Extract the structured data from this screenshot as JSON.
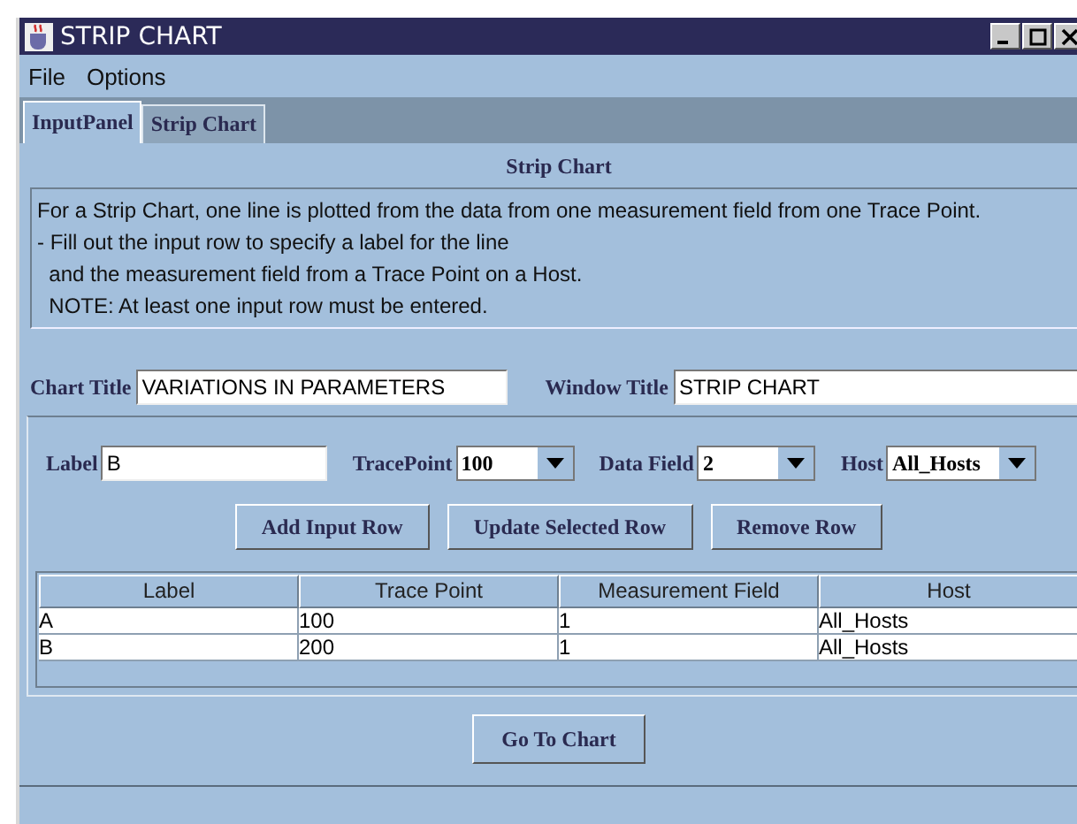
{
  "window": {
    "title": "STRIP CHART"
  },
  "menu": [
    "File",
    "Options"
  ],
  "tabs": [
    {
      "label": "InputPanel",
      "selected": true
    },
    {
      "label": "Strip Chart",
      "selected": false
    }
  ],
  "heading": "Strip Chart",
  "description": [
    "For a Strip Chart, one line is plotted from the data from one measurement field from one Trace Point.",
    "- Fill out the input row to specify a label for the line",
    "  and the measurement field from a Trace Point on a Host.",
    "  NOTE: At least one input row must be entered."
  ],
  "title_fields": [
    {
      "label": "Chart Title",
      "value": "VARIATIONS IN PARAMETERS"
    },
    {
      "label": "Window Title",
      "value": "STRIP CHART"
    }
  ],
  "input_row": [
    {
      "kind": "text",
      "label": "Label",
      "value": "B"
    },
    {
      "kind": "combo",
      "label": "TracePoint",
      "value": "100"
    },
    {
      "kind": "combo",
      "label": "Data Field",
      "value": "2"
    },
    {
      "kind": "combo",
      "label": "Host",
      "value": "All_Hosts"
    }
  ],
  "buttons": [
    "Add Input Row",
    "Update Selected Row",
    "Remove Row"
  ],
  "table": {
    "columns": [
      "Label",
      "Trace Point",
      "Measurement Field",
      "Host"
    ],
    "rows": [
      [
        "A",
        "100",
        "1",
        "All_Hosts"
      ],
      [
        "B",
        "200",
        "1",
        "All_Hosts"
      ]
    ]
  },
  "footer_button": "Go To Chart"
}
